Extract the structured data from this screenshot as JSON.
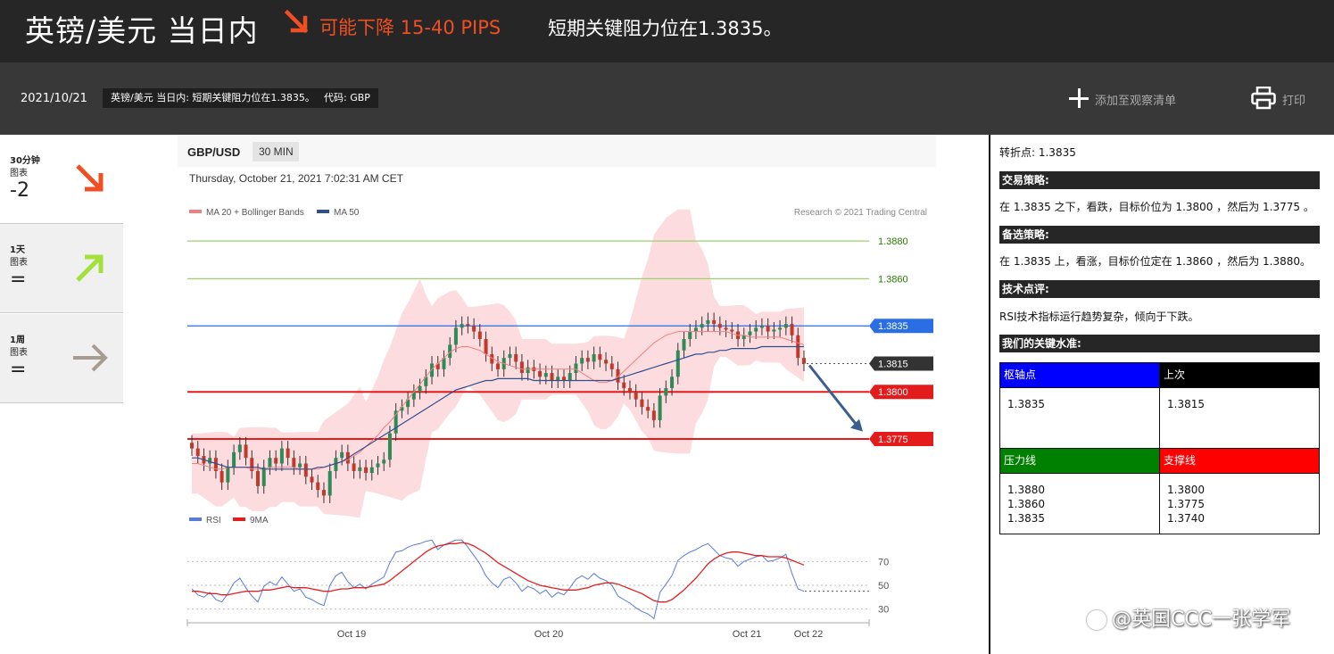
{
  "banner": {
    "pair": "英镑/美元 当日内",
    "direction_icon": "arrow-down-right-icon",
    "direction_text": "可能下降 15-40 PIPS",
    "headline": "短期关键阻力位在1.3835。",
    "accent_color": "#f04e23"
  },
  "subbar": {
    "date": "2021/10/21",
    "tag_title": "英镑/美元 当日内: 短期关键阻力位在1.3835。",
    "tag_code": "代码: GBP",
    "watchlist_label": "添加至观察清单",
    "print_label": "打印"
  },
  "timeframes": [
    {
      "title": "30分钟",
      "subtitle": "图表",
      "value": "-2",
      "icon": "arrow-down-right-icon",
      "color": "#f04e23"
    },
    {
      "title": "1天",
      "subtitle": "图表",
      "value": "=",
      "icon": "arrow-up-right-icon",
      "color": "#a4e03a"
    },
    {
      "title": "1周",
      "subtitle": "图表",
      "value": "=",
      "icon": "arrow-right-icon",
      "color": "#a89c90"
    }
  ],
  "chart": {
    "symbol": "GBP/USD",
    "interval": "30 MIN",
    "timestamp": "Thursday, October 21, 2021 7:02:31 AM CET",
    "legend_ma20": "MA 20 + Bollinger Bands",
    "legend_ma50": "MA 50",
    "copyright": "Research © 2021 Trading Central",
    "legend_rsi": "RSI",
    "legend_9ma": "9MA",
    "colors": {
      "ma20": "#f08080",
      "ma50": "#2f4f8f",
      "rsi": "#5b7bd5",
      "ma9": "#e02020",
      "up": "#2e8b57",
      "down": "#c0392b",
      "band": "#fbd0d4",
      "blue": "#2a6ee6",
      "red": "#e31b1b",
      "green": "#9ad36a"
    }
  },
  "chart_data": {
    "type": "candlestick",
    "price_levels": [
      {
        "label": "1.3880",
        "value": 1.388,
        "kind": "resistance"
      },
      {
        "label": "1.3860",
        "value": 1.386,
        "kind": "resistance"
      },
      {
        "label": "1.3835",
        "value": 1.3835,
        "kind": "pivot"
      },
      {
        "label": "1.3815",
        "value": 1.3815,
        "kind": "last"
      },
      {
        "label": "1.3800",
        "value": 1.38,
        "kind": "support"
      },
      {
        "label": "1.3775",
        "value": 1.3775,
        "kind": "support"
      }
    ],
    "x_ticks": [
      "Oct 19",
      "Oct 20",
      "Oct 21",
      "Oct 22"
    ],
    "rsi_ticks": [
      "70",
      "50",
      "30"
    ],
    "rsi_levels": [
      70,
      50,
      30
    ],
    "close": [
      1.377,
      1.3766,
      1.3762,
      1.3765,
      1.3758,
      1.3752,
      1.376,
      1.3768,
      1.3772,
      1.3765,
      1.3758,
      1.375,
      1.376,
      1.3765,
      1.3762,
      1.377,
      1.3765,
      1.376,
      1.3762,
      1.3755,
      1.3752,
      1.3748,
      1.3745,
      1.3758,
      1.3765,
      1.3768,
      1.3762,
      1.3758,
      1.376,
      1.3757,
      1.376,
      1.3762,
      1.3764,
      1.3778,
      1.379,
      1.3792,
      1.3796,
      1.38,
      1.3803,
      1.3808,
      1.3815,
      1.3812,
      1.3818,
      1.3825,
      1.3834,
      1.3836,
      1.3835,
      1.3832,
      1.3828,
      1.382,
      1.3815,
      1.3812,
      1.3818,
      1.382,
      1.3816,
      1.381,
      1.3813,
      1.3811,
      1.3808,
      1.381,
      1.3806,
      1.3808,
      1.3806,
      1.381,
      1.3815,
      1.3818,
      1.3816,
      1.382,
      1.3817,
      1.3815,
      1.3812,
      1.3805,
      1.3802,
      1.38,
      1.3796,
      1.3792,
      1.379,
      1.3785,
      1.3798,
      1.3802,
      1.3808,
      1.3822,
      1.3828,
      1.3832,
      1.3834,
      1.3836,
      1.3838,
      1.3836,
      1.3834,
      1.3833,
      1.3832,
      1.3828,
      1.383,
      1.3832,
      1.3834,
      1.3835,
      1.3832,
      1.3833,
      1.3834,
      1.3836,
      1.383,
      1.3818,
      1.3815
    ],
    "ma20": [
      1.3762,
      1.3762,
      1.3761,
      1.376,
      1.3759,
      1.3759,
      1.376,
      1.376,
      1.376,
      1.376,
      1.3759,
      1.3759,
      1.3759,
      1.376,
      1.376,
      1.376,
      1.376,
      1.376,
      1.3759,
      1.3759,
      1.3759,
      1.3759,
      1.376,
      1.3761,
      1.3762,
      1.3763,
      1.3764,
      1.3766,
      1.3768,
      1.3771,
      1.3774,
      1.3777,
      1.3781,
      1.3784,
      1.3788,
      1.3792,
      1.3796,
      1.38,
      1.3804,
      1.3808,
      1.3812,
      1.3815,
      1.3818,
      1.3821,
      1.3823,
      1.3824,
      1.3824,
      1.3823,
      1.3822,
      1.382,
      1.3818,
      1.3816,
      1.3815,
      1.3814,
      1.3813,
      1.3812,
      1.3812,
      1.3812,
      1.3812,
      1.3812,
      1.3812,
      1.3812,
      1.3812,
      1.3812,
      1.3812,
      1.381,
      1.3808,
      1.3806,
      1.3805,
      1.3805,
      1.3806,
      1.3808,
      1.3811,
      1.3814,
      1.3817,
      1.382,
      1.3823,
      1.3826,
      1.3828,
      1.383,
      1.3831,
      1.3832,
      1.3832,
      1.3832,
      1.3832,
      1.3832,
      1.3832,
      1.3832,
      1.3832,
      1.3832,
      1.3831,
      1.383,
      1.383,
      1.3829,
      1.3829,
      1.3829,
      1.3829,
      1.3829,
      1.3829,
      1.3828,
      1.3827,
      1.3826,
      1.3825
    ],
    "ma50": [
      1.3765,
      1.3765,
      1.3764,
      1.3763,
      1.3762,
      1.3761,
      1.376,
      1.376,
      1.376,
      1.376,
      1.376,
      1.376,
      1.3759,
      1.3759,
      1.3759,
      1.3759,
      1.3759,
      1.3759,
      1.3759,
      1.3759,
      1.3759,
      1.376,
      1.376,
      1.3761,
      1.3762,
      1.3763,
      1.3765,
      1.3767,
      1.3769,
      1.3771,
      1.3773,
      1.3775,
      1.3777,
      1.3779,
      1.3781,
      1.3783,
      1.3785,
      1.3787,
      1.3789,
      1.3791,
      1.3793,
      1.3795,
      1.3797,
      1.3799,
      1.3801,
      1.3802,
      1.3803,
      1.3804,
      1.3805,
      1.3806,
      1.3806,
      1.3807,
      1.3807,
      1.3807,
      1.3807,
      1.3807,
      1.3807,
      1.3806,
      1.3806,
      1.3806,
      1.3806,
      1.3806,
      1.3806,
      1.3806,
      1.3806,
      1.3806,
      1.3806,
      1.3806,
      1.3806,
      1.3806,
      1.3806,
      1.3807,
      1.3808,
      1.3809,
      1.381,
      1.3811,
      1.3812,
      1.3813,
      1.3814,
      1.3815,
      1.3816,
      1.3817,
      1.3818,
      1.3819,
      1.382,
      1.382,
      1.3821,
      1.3821,
      1.3822,
      1.3822,
      1.3823,
      1.3823,
      1.3823,
      1.3823,
      1.3823,
      1.3824,
      1.3824,
      1.3824,
      1.3824,
      1.3824,
      1.3824,
      1.3824,
      1.3824
    ],
    "rsi": [
      47,
      42,
      40,
      44,
      38,
      36,
      43,
      52,
      56,
      48,
      41,
      36,
      49,
      53,
      50,
      57,
      51,
      45,
      47,
      40,
      38,
      35,
      33,
      50,
      58,
      61,
      53,
      48,
      51,
      47,
      51,
      54,
      57,
      69,
      78,
      79,
      82,
      84,
      85,
      87,
      88,
      80,
      84,
      86,
      88,
      88,
      82,
      75,
      68,
      58,
      52,
      48,
      55,
      57,
      52,
      45,
      49,
      47,
      43,
      46,
      40,
      44,
      42,
      48,
      55,
      58,
      55,
      60,
      56,
      54,
      50,
      41,
      38,
      35,
      31,
      28,
      26,
      22,
      44,
      51,
      58,
      71,
      75,
      78,
      80,
      83,
      85,
      80,
      75,
      73,
      72,
      66,
      70,
      72,
      74,
      75,
      70,
      71,
      73,
      76,
      60,
      47,
      45
    ],
    "rsi_ma9": [
      45,
      45,
      44,
      43,
      43,
      42,
      42,
      43,
      44,
      45,
      45,
      45,
      46,
      46,
      47,
      48,
      49,
      48,
      48,
      48,
      47,
      46,
      45,
      45,
      46,
      47,
      47,
      48,
      48,
      48,
      49,
      50,
      51,
      54,
      58,
      62,
      66,
      70,
      74,
      78,
      81,
      83,
      84,
      85,
      85,
      86,
      85,
      83,
      80,
      77,
      73,
      69,
      66,
      63,
      60,
      57,
      54,
      52,
      50,
      49,
      48,
      47,
      46,
      46,
      46,
      47,
      48,
      50,
      51,
      52,
      52,
      51,
      49,
      47,
      45,
      43,
      40,
      37,
      36,
      36,
      38,
      42,
      46,
      51,
      56,
      62,
      68,
      72,
      75,
      77,
      78,
      78,
      77,
      76,
      75,
      75,
      74,
      74,
      74,
      73,
      71,
      69,
      67
    ]
  },
  "right": {
    "pivot_line": "转折点: 1.3835",
    "strategy_header": "交易策略:",
    "strategy_text": "在 1.3835 之下，看跌，目标价位为 1.3800 ，然后为 1.3775 。",
    "alt_header": "备选策略:",
    "alt_text": "在 1.3835 上，看涨，目标价位定在 1.3860 ，然后为 1.3880。",
    "comment_header": "技术点评:",
    "comment_text": "RSI技术指标运行趋势复杂，倾向于下跌。",
    "levels_header": "我们的关键水准:",
    "table": {
      "pivot_label": "枢轴点",
      "pivot_value": "1.3835",
      "last_label": "上次",
      "last_value": "1.3815",
      "res_label": "压力线",
      "res_values": [
        "1.3880",
        "1.3860",
        "1.3835"
      ],
      "sup_label": "支撑线",
      "sup_values": [
        "1.3800",
        "1.3775",
        "1.3740"
      ],
      "colors": {
        "pivot": "#0000ff",
        "last": "#000000",
        "res": "#008000",
        "sup": "#ff0000"
      }
    }
  },
  "watermark": "@英国CCC一张学军"
}
